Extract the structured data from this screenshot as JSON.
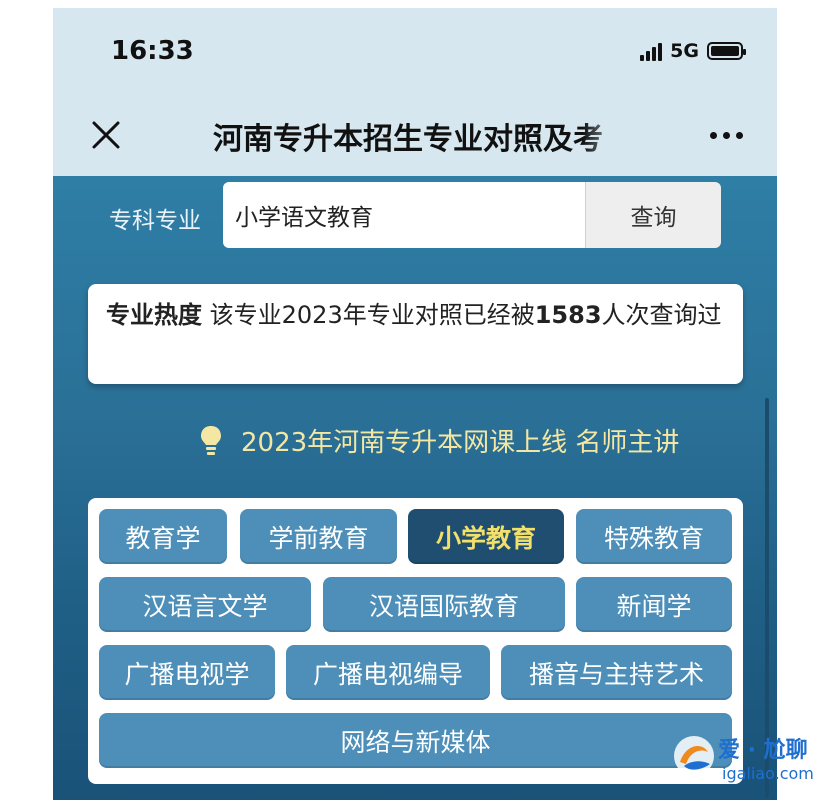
{
  "status_bar": {
    "time": "16:33",
    "network": "5G"
  },
  "header": {
    "close_icon": "close-icon",
    "title": "河南专升本招生专业对照及考",
    "more_icon": "more-icon"
  },
  "search": {
    "label": "专科专业",
    "value": "小学语文教育",
    "button_label": "查询"
  },
  "heat_card": {
    "title": "专业热度",
    "text_before": "该专业2023年专业对照已经被",
    "count": "1583",
    "text_after": "人次查询过"
  },
  "promo": {
    "icon": "lightbulb-icon",
    "text": "2023年河南专升本网课上线 名师主讲"
  },
  "majors": {
    "items": [
      {
        "label": "教育学",
        "active": false
      },
      {
        "label": "学前教育",
        "active": false
      },
      {
        "label": "小学教育",
        "active": true
      },
      {
        "label": "特殊教育",
        "active": false
      },
      {
        "label": "汉语言文学",
        "active": false
      },
      {
        "label": "汉语国际教育",
        "active": false
      },
      {
        "label": "新闻学",
        "active": false
      },
      {
        "label": "广播电视学",
        "active": false
      },
      {
        "label": "广播电视编导",
        "active": false
      },
      {
        "label": "播音与主持艺术",
        "active": false
      },
      {
        "label": "网络与新媒体",
        "active": false
      }
    ]
  },
  "colors": {
    "page_blue": "#2e7ea6",
    "tag_blue": "#4d8fb8",
    "tag_active": "#1f4e70",
    "active_text": "#f3e06a",
    "promo_text": "#f3e7a3"
  },
  "watermark": {
    "brand": "爱 · 尬聊",
    "url": "igaliao.com"
  }
}
